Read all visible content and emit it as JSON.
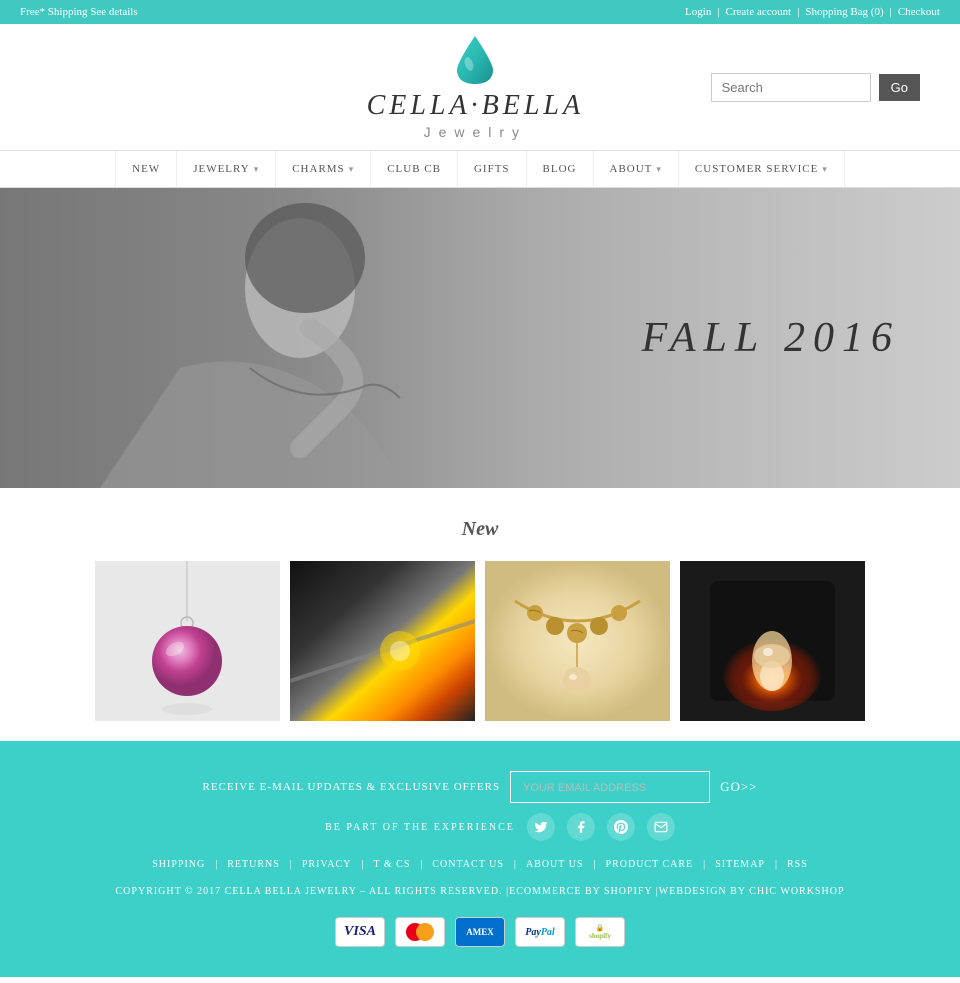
{
  "topbar": {
    "left_text": "Free* Shipping See details",
    "right_links": [
      "Login",
      "Create account",
      "Shopping Bag (0)",
      "Checkout"
    ],
    "separators": [
      "|",
      "|",
      "|"
    ]
  },
  "header": {
    "logo_name": "CELLA·BELLA",
    "logo_subtitle": "Jewelry",
    "search_placeholder": "Search",
    "go_button": "Go"
  },
  "nav": {
    "items": [
      {
        "label": "NEW",
        "has_arrow": false
      },
      {
        "label": "JEWELRY",
        "has_arrow": true
      },
      {
        "label": "CHARMS",
        "has_arrow": true
      },
      {
        "label": "CLUB CB",
        "has_arrow": false
      },
      {
        "label": "GIFTS",
        "has_arrow": false
      },
      {
        "label": "BLOG",
        "has_arrow": false
      },
      {
        "label": "ABOUT",
        "has_arrow": true
      },
      {
        "label": "CUSTOMER SERVICE",
        "has_arrow": true
      }
    ]
  },
  "hero": {
    "text": "FALL 2016"
  },
  "products_section": {
    "title": "New",
    "products": [
      {
        "id": 1,
        "type": "pendant-necklace"
      },
      {
        "id": 2,
        "type": "glassblowing-bw"
      },
      {
        "id": 3,
        "type": "gold-necklace"
      },
      {
        "id": 4,
        "type": "furnace-fire"
      }
    ]
  },
  "footer": {
    "newsletter_label": "RECEIVE E-MAIL UPDATES & EXCLUSIVE OFFERS",
    "newsletter_placeholder": "YOUR EMAIL ADDRESS",
    "go_label": "GO>>",
    "social_label": "BE PART OF THE EXPERIENCE",
    "social_icons": [
      "twitter",
      "facebook",
      "pinterest",
      "email"
    ],
    "links": [
      {
        "label": "SHIPPING"
      },
      {
        "label": "RETURNS"
      },
      {
        "label": "PRIVACY"
      },
      {
        "label": "T & CS"
      },
      {
        "label": "CONTACT US"
      },
      {
        "label": "ABOUT US"
      },
      {
        "label": "PRODUCT CARE"
      },
      {
        "label": "SITEMAP"
      },
      {
        "label": "RSS"
      }
    ],
    "copyright": "COPYRIGHT © 2017 CELLA BELLA JEWELRY – ALL RIGHTS RESERVED. |ECOMMERCE BY SHOPIFY |WEBDESIGN BY CHIC WORKSHOP",
    "payment_methods": [
      "VISA",
      "MC",
      "AMEX",
      "PAYPAL",
      "SHOPIFY"
    ]
  }
}
